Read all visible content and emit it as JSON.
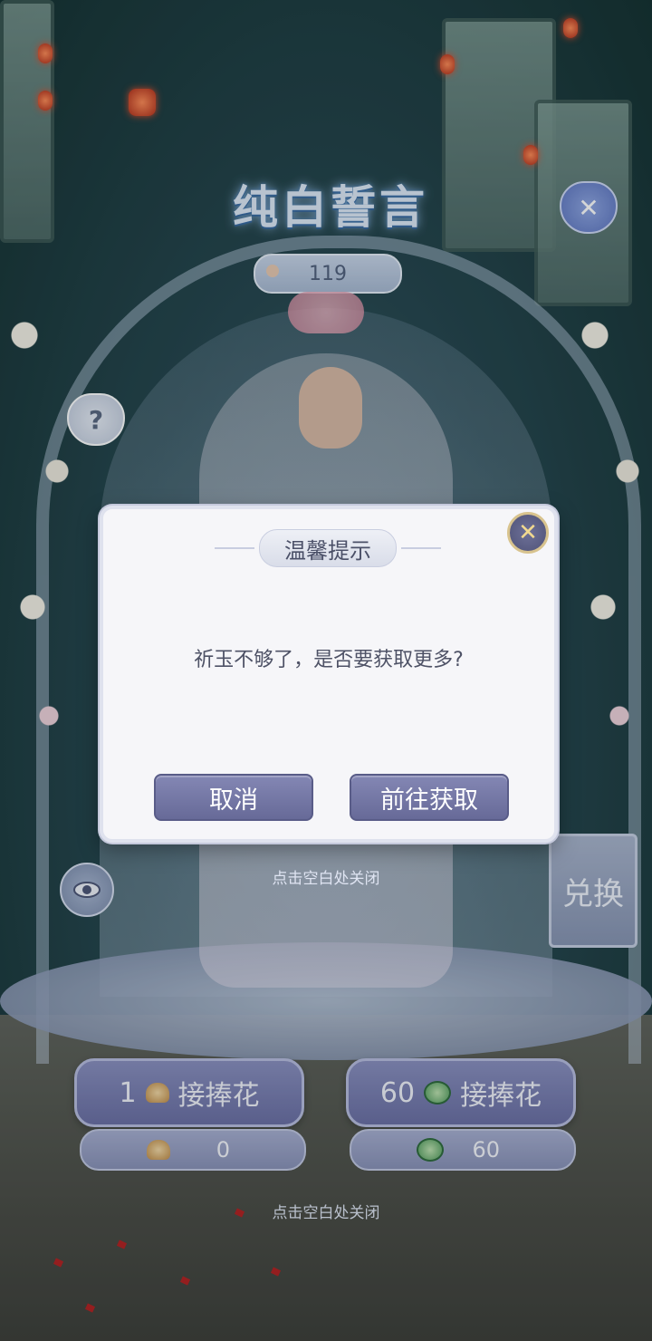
{
  "game": {
    "title": "纯白誓言",
    "counter_value": "119"
  },
  "side_buttons": {
    "close_icon": "heart-close-icon",
    "help_label": "?",
    "eye_icon": "eye-icon",
    "exchange_label": "兑换"
  },
  "actions": {
    "single": {
      "count": "1",
      "label": "接捧花",
      "currency_icon": "gold-ingot-icon"
    },
    "multi": {
      "count": "60",
      "label": "接捧花",
      "currency_icon": "jade-coin-icon"
    }
  },
  "balances": {
    "gold": "0",
    "jade": "60"
  },
  "hints": {
    "top": "点击空白处关闭",
    "bottom": "点击空白处关闭"
  },
  "dialog": {
    "title": "温馨提示",
    "message": "祈玉不够了，是否要获取更多?",
    "cancel_label": "取消",
    "confirm_label": "前往获取",
    "close_glyph": "✕"
  },
  "colors": {
    "button_purple": "#6b6fa4",
    "dialog_bg": "#f6f6f9",
    "title_blue": "#dfe9f7"
  }
}
